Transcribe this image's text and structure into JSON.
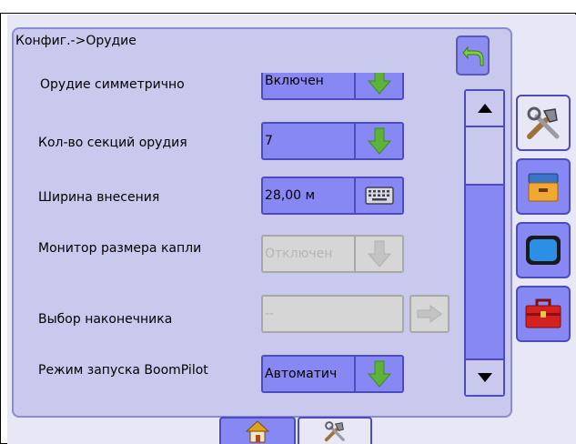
{
  "header": {
    "title": "Конфиг.->Орудие"
  },
  "rows": [
    {
      "label": "Орудие симметрично",
      "value": "Включен",
      "control": "dropdown",
      "enabled": true
    },
    {
      "label": "Кол-во секций орудия",
      "value": "7",
      "control": "dropdown",
      "enabled": true
    },
    {
      "label": "Ширина внесения",
      "value": "28,00 м",
      "control": "keyboard",
      "enabled": true
    },
    {
      "label": "Монитор размера капли",
      "value": "Отключен",
      "control": "dropdown",
      "enabled": false
    },
    {
      "label": "Выбор наконечника",
      "value": "--",
      "control": "next",
      "enabled": false
    },
    {
      "label": "Режим запуска BoomPilot",
      "value": "Автоматич",
      "control": "dropdown",
      "enabled": true
    }
  ],
  "side_icons": [
    "tools-icon",
    "cabinet-icon",
    "display-icon",
    "toolbox-icon"
  ],
  "bottom_tabs": [
    "home-icon",
    "tools-icon"
  ],
  "colors": {
    "accent": "#8888f4",
    "panel": "#c9c9ee",
    "border": "#4c4cbc",
    "green_arrow": "#5cb338"
  }
}
